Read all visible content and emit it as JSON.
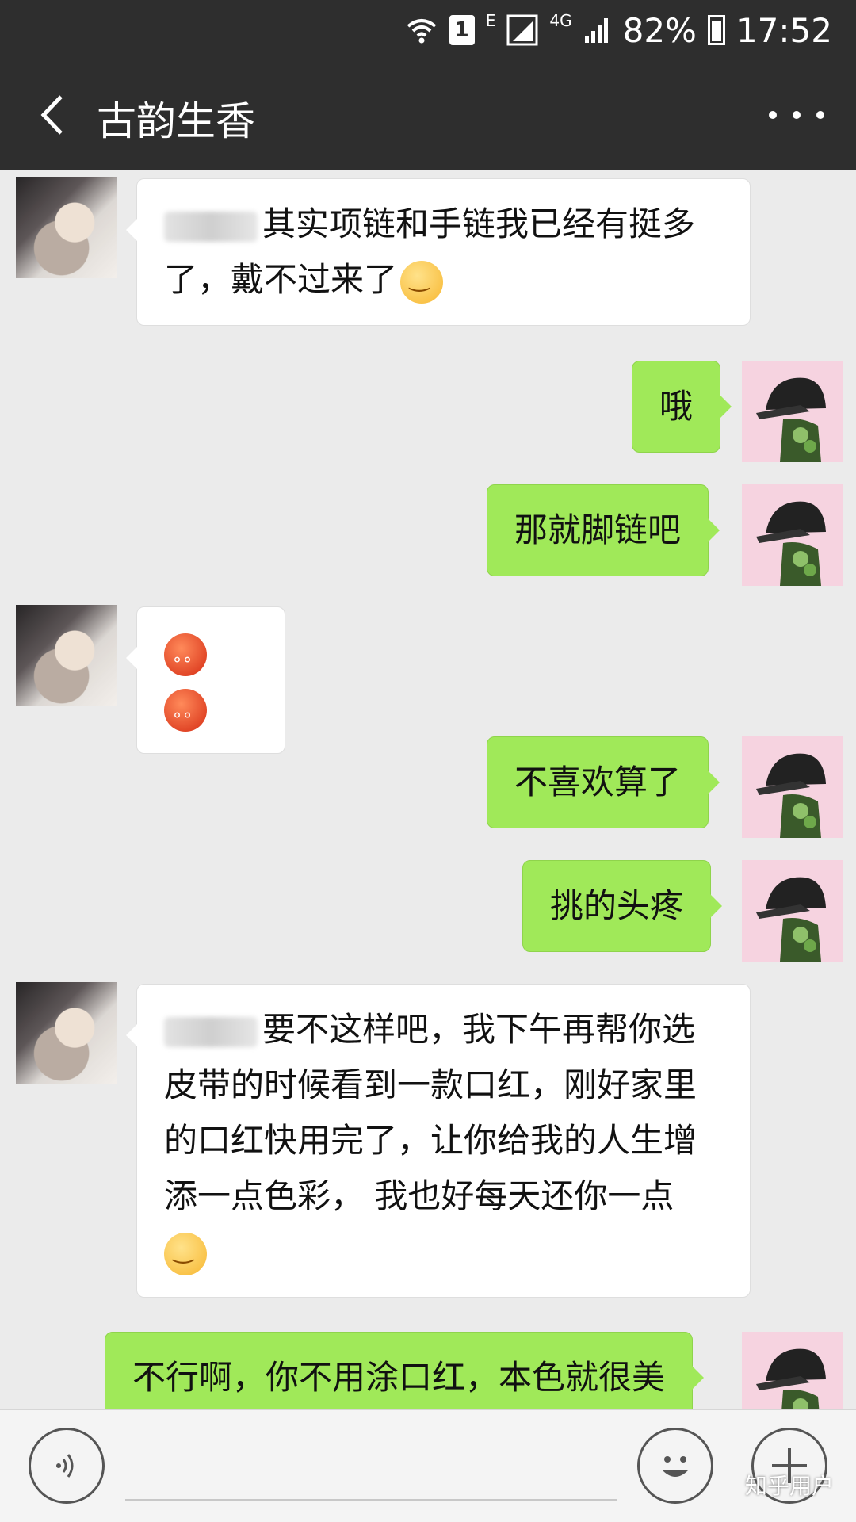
{
  "status_bar": {
    "sim_label": "1",
    "network_e": "E",
    "network_4g": "4G",
    "battery_percent": "82%",
    "time": "17:52",
    "battery_level": 0.82
  },
  "header": {
    "title": "古韵生香"
  },
  "messages": [
    {
      "side": "left",
      "text": "其实项链和手链我已经有挺多了，戴不过来了"
    },
    {
      "side": "right",
      "text": "哦"
    },
    {
      "side": "right",
      "text": "那就脚链吧"
    },
    {
      "side": "left",
      "text": ""
    },
    {
      "side": "right",
      "text": "不喜欢算了"
    },
    {
      "side": "right",
      "text": "挑的头疼"
    },
    {
      "side": "left",
      "text": "要不这样吧，我下午再帮你选皮带的时候看到一款口红，刚好家里的口红快用完了，让你给我的人生增添一点色彩， 我也好每天还你一点"
    },
    {
      "side": "right",
      "text": "不行啊，你不用涂口红，本色就很美"
    }
  ],
  "input_bar": {
    "watermark": "知乎用户"
  },
  "colors": {
    "header_bg": "#2e2e2e",
    "chat_bg": "#ebebeb",
    "sent_bubble": "#a0e959",
    "received_bubble": "#ffffff"
  }
}
